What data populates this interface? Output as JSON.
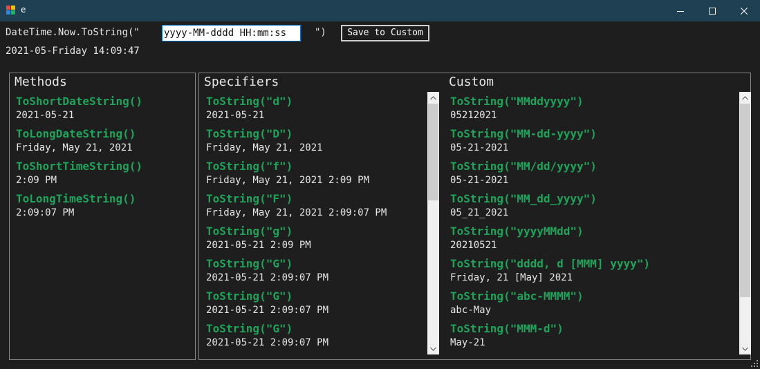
{
  "window": {
    "title": "e",
    "icons": {
      "app": "app-icon",
      "minimize": "minimize-icon",
      "maximize": "maximize-icon",
      "close": "close-icon"
    }
  },
  "format_bar": {
    "prefix": "DateTime.Now.ToString(\"",
    "input_value": "yyyy-MM-dddd HH:mm:ss",
    "suffix": "\")",
    "save_label": "Save to Custom",
    "result": "2021-05-Friday 14:09:47"
  },
  "methods": {
    "title": "Methods",
    "items": [
      {
        "method": "ToShortDateString()",
        "value": "2021-05-21"
      },
      {
        "method": "ToLongDateString()",
        "value": "Friday, May 21, 2021"
      },
      {
        "method": "ToShortTimeString()",
        "value": "2:09 PM"
      },
      {
        "method": "ToLongTimeString()",
        "value": "2:09:07 PM"
      }
    ]
  },
  "specifiers": {
    "title": "Specifiers",
    "items": [
      {
        "method": "ToString(\"d\")",
        "value": "2021-05-21"
      },
      {
        "method": "ToString(\"D\")",
        "value": "Friday, May 21, 2021"
      },
      {
        "method": "ToString(\"f\")",
        "value": "Friday, May 21, 2021 2:09 PM"
      },
      {
        "method": "ToString(\"F\")",
        "value": "Friday, May 21, 2021 2:09:07 PM"
      },
      {
        "method": "ToString(\"g\")",
        "value": "2021-05-21 2:09 PM"
      },
      {
        "method": "ToString(\"G\")",
        "value": "2021-05-21 2:09:07 PM"
      },
      {
        "method": "ToString(\"G\")",
        "value": "2021-05-21 2:09:07 PM"
      },
      {
        "method": "ToString(\"G\")",
        "value": "2021-05-21 2:09:07 PM"
      }
    ],
    "scroll_position": 0.0
  },
  "custom": {
    "title": "Custom",
    "items": [
      {
        "method": "ToString(\"MMddyyyy\")",
        "value": "05212021"
      },
      {
        "method": "ToString(\"MM-dd-yyyy\")",
        "value": "05-21-2021"
      },
      {
        "method": "ToString(\"MM/dd/yyyy\")",
        "value": "05-21-2021"
      },
      {
        "method": "ToString(\"MM_dd_yyyy\")",
        "value": "05_21_2021"
      },
      {
        "method": "ToString(\"yyyyMMdd\")",
        "value": "20210521"
      },
      {
        "method": "ToString(\"dddd, d [MMM] yyyy\")",
        "value": "Friday, 21 [May] 2021"
      },
      {
        "method": "ToString(\"abc-MMMM\")",
        "value": "abc-May"
      },
      {
        "method": "ToString(\"MMM-d\")",
        "value": "May-21"
      }
    ],
    "scroll_position": 0.0
  },
  "colors": {
    "titlebar": "#1f3f53",
    "background": "#1e1e1e",
    "method_text": "#1ea35a",
    "value_text": "#e6e6e6",
    "panel_border": "#8a8a8a"
  }
}
